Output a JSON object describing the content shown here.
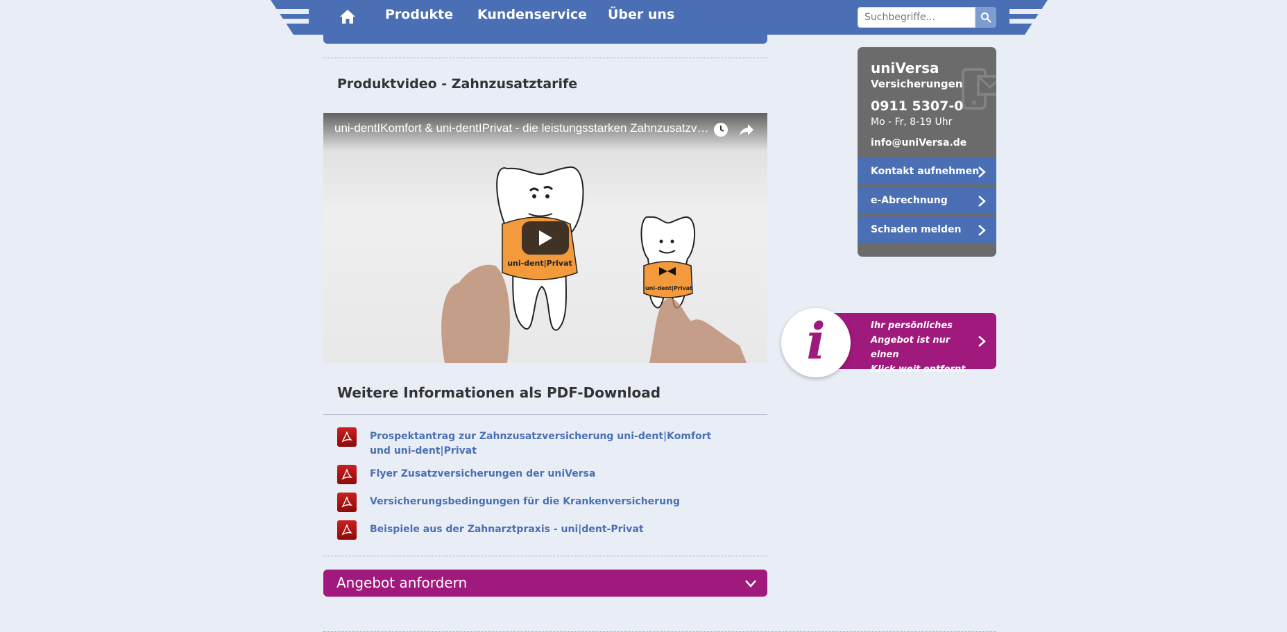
{
  "nav": {
    "home_icon": "home-icon",
    "items": [
      {
        "label": "Produkte"
      },
      {
        "label": "Kundenservice"
      },
      {
        "label": "Über uns"
      }
    ],
    "search_placeholder": "Suchbegriffe...",
    "search_icon": "search-icon"
  },
  "main": {
    "video_section_title": "Produktvideo - Zahnzusatztarife",
    "video": {
      "title": "uni-dentIKomfort & uni-dentIPrivat - die leistungsstarken Zahnzusatzversicherungen",
      "watch_later_icon": "clock-icon",
      "share_icon": "share-icon",
      "play_icon": "play-icon",
      "label_left": "uni-dent|Privat",
      "label_right": "uni-dent|Privat"
    },
    "pdf_section_title": "Weitere Informationen als PDF-Download",
    "pdf_links": [
      {
        "label": "Prospektantrag zur Zahnzusatzversicherung uni-dent|Komfort und uni-dent|Privat"
      },
      {
        "label": "Flyer Zusatzversicherungen der uniVersa"
      },
      {
        "label": "Versicherungsbedingungen für die Krankenversicherung"
      },
      {
        "label": "Beispiele aus der Zahnarztpraxis - uni|dent-Privat"
      }
    ],
    "accordion_label": "Angebot anfordern"
  },
  "sidebar": {
    "brand": "uniVersa",
    "brand_sub": "Versicherungen",
    "phone": "0911 5307-0",
    "hours": "Mo - Fr, 8-19 Uhr",
    "email": "info@uniVersa.de",
    "buttons": [
      {
        "label": "Kontakt aufnehmen"
      },
      {
        "label": "e-Abrechnung"
      },
      {
        "label": "Schaden melden"
      }
    ],
    "info_banner": {
      "icon_letter": "i",
      "line1": "Ihr persönliches",
      "line2": "Angebot ist nur einen",
      "line3": "Klick weit entfernt"
    }
  },
  "colors": {
    "brand_blue": "#4a6fb4",
    "accent_magenta": "#a0197c",
    "contact_gray": "#6b6b6b",
    "page_bg": "#e9eef6"
  }
}
